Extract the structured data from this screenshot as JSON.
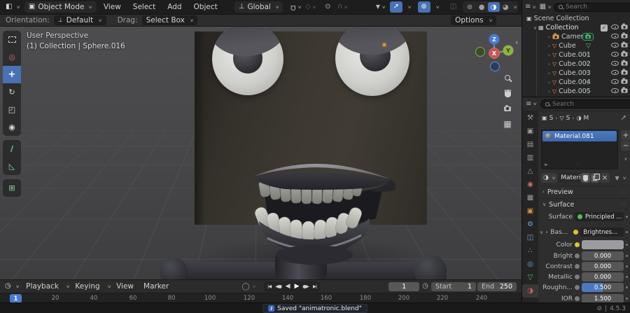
{
  "viewport_header": {
    "mode": "Object Mode",
    "menus": [
      "View",
      "Select",
      "Add",
      "Object"
    ],
    "orientation": "Global"
  },
  "tool_settings": {
    "orientation_label": "Orientation:",
    "orientation_value": "Default",
    "drag_label": "Drag:",
    "drag_value": "Select Box",
    "options_label": "Options"
  },
  "viewport": {
    "view_name": "User Perspective",
    "context_path": "(1) Collection | Sphere.016",
    "gizmo": {
      "x": "X",
      "y": "Y",
      "z": "Z"
    },
    "tools": [
      "",
      "◎",
      "+",
      "↻",
      "◰",
      "◉",
      "∕",
      "◺",
      "⊞"
    ]
  },
  "outliner": {
    "search_placeholder": "Search",
    "rows": [
      {
        "name": "Scene Collection"
      },
      {
        "name": "Collection"
      },
      {
        "name": "Camera"
      },
      {
        "name": "Cube"
      },
      {
        "name": "Cube.001"
      },
      {
        "name": "Cube.002"
      },
      {
        "name": "Cube.003"
      },
      {
        "name": "Cube.004"
      },
      {
        "name": "Cube.005"
      }
    ]
  },
  "properties": {
    "search_placeholder": "Search",
    "tabs": [
      {
        "name": "tool",
        "glyph": "⚒"
      },
      {
        "name": "render",
        "glyph": "▣"
      },
      {
        "name": "output",
        "glyph": "▤"
      },
      {
        "name": "view-layer",
        "glyph": "▥"
      },
      {
        "name": "scene",
        "glyph": "△"
      },
      {
        "name": "world",
        "glyph": "◉"
      },
      {
        "name": "collection",
        "glyph": "▦"
      },
      {
        "name": "object",
        "glyph": "▣"
      },
      {
        "name": "modifiers",
        "glyph": "⚙"
      },
      {
        "name": "constraints",
        "glyph": "◫"
      },
      {
        "name": "particles",
        "glyph": "∴"
      },
      {
        "name": "physics",
        "glyph": "◎"
      },
      {
        "name": "data",
        "glyph": "▽"
      },
      {
        "name": "material",
        "glyph": "◑"
      }
    ],
    "breadcrumb": {
      "object": "S",
      "data": "S",
      "material": "M"
    },
    "material_slot": "Material.081",
    "material_name": "Materi...",
    "preview_panel": "Preview",
    "surface_panel": "Surface",
    "surface_label": "Surface",
    "surface_value": "Principled ...",
    "base_label": "Bas...",
    "base_value": "Brightnes...",
    "color_label": "Color",
    "fields": [
      {
        "label": "Bright",
        "value": "0.000"
      },
      {
        "label": "Contrast",
        "value": "0.000"
      },
      {
        "label": "Metallic",
        "value": "0.000"
      },
      {
        "label": "Roughn...",
        "value": "0.500"
      },
      {
        "label": "IOR",
        "value": "1.500"
      }
    ]
  },
  "timeline": {
    "menus": [
      "Playback",
      "Keying",
      "View",
      "Marker"
    ],
    "transport": [
      "|◀",
      "◀●",
      "◀",
      "▶",
      "●▶",
      "▶|"
    ],
    "current_frame": "1",
    "start_label": "Start",
    "start_value": "1",
    "end_label": "End",
    "end_value": "250",
    "ruler_ticks": [
      "20",
      "40",
      "60",
      "80",
      "100",
      "120",
      "140",
      "160",
      "180",
      "200",
      "220",
      "240"
    ],
    "current_marker": "1"
  },
  "status": {
    "saved_message": "Saved \"animatronic.blend\"",
    "version": "4.5.3"
  },
  "icons": {
    "chevron": "∨",
    "submenu": "›",
    "tree_open": "∨",
    "tree_closed": "›",
    "editor_3d": "◧",
    "mode_icon": "▣",
    "orientation_axis": "⊥",
    "magnet": "Ω",
    "snap_with": "◇",
    "prop_edit": "⊙",
    "falloff": "∩",
    "vis_filter": "▼",
    "gizmo": "↗",
    "overlays": "⊚",
    "xray": "◫",
    "shade_wire": "⊕",
    "shade_solid": "●",
    "shade_material": "◑",
    "shade_render": "◕",
    "outliner_display": "≡",
    "display_mode": "▦",
    "filter": "▼",
    "props_editor": "≡",
    "collection": "▦",
    "scene_collection": "▣",
    "mesh": "▽",
    "grip": "∷",
    "expand_play": "►",
    "close": "×",
    "plus": "+",
    "minus": "−",
    "pin": "⊸",
    "clock": "◷",
    "record": "◯",
    "ortho": "▦",
    "offline": "⊘",
    "info": "i",
    "check": "✓"
  },
  "colors": {
    "accent_blue": "#4772b3",
    "selection_blue": "#4b79c0",
    "mesh_orange": "#e8913c",
    "data_green": "#4fc07a",
    "origin_orange": "#ff9226"
  }
}
